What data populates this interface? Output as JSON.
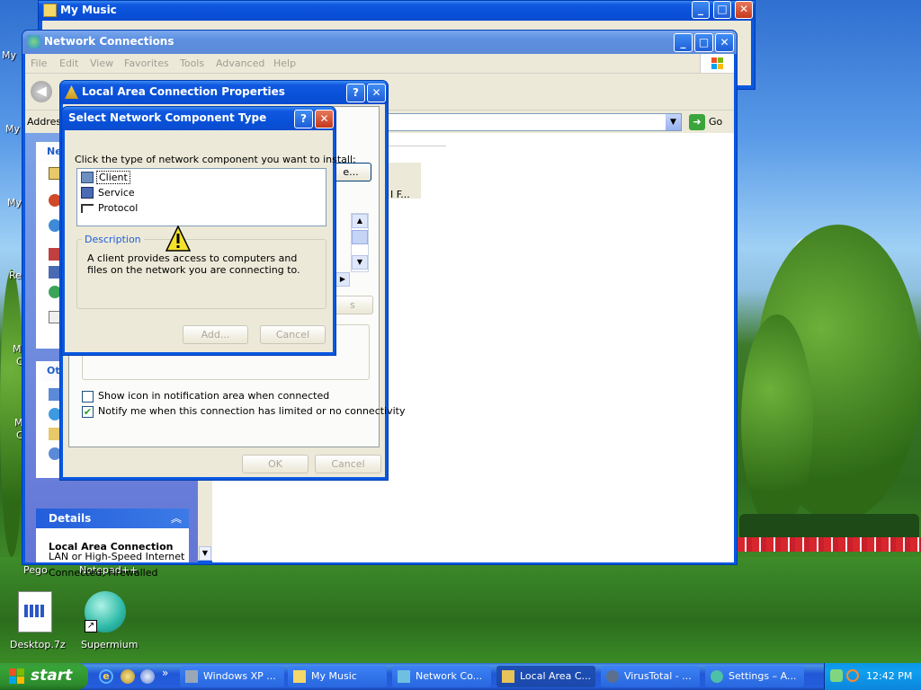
{
  "desktop": {
    "left_labels": [
      "My",
      "My",
      "My",
      "Re",
      "M",
      "C",
      "M",
      "C"
    ],
    "icons": [
      {
        "label": "Pego"
      },
      {
        "label": "Notepad++"
      },
      {
        "label": "Desktop.7z"
      },
      {
        "label": "Supermium"
      }
    ]
  },
  "my_music_window": {
    "title": "My Music"
  },
  "network_window": {
    "title": "Network Connections",
    "menu": [
      "File",
      "Edit",
      "View",
      "Favorites",
      "Tools",
      "Advanced",
      "Help"
    ],
    "address_label": "Addres",
    "go_label": "Go",
    "sidebar": {
      "network_tasks_header": "Ne",
      "other_places_header": "Ot",
      "details_header": "Details",
      "details_title": "Local Area Connection",
      "details_line1": "LAN or High-Speed Internet",
      "details_line2": "Connected, Firewalled"
    },
    "partial_text": "I F..."
  },
  "lac_properties": {
    "title": "Local Area Connection Properties",
    "help_btn": "?",
    "configure_partial": "e...",
    "properties_partial": "s",
    "show_icon_label": "Show icon in notification area when connected",
    "show_icon_checked": false,
    "notify_label": "Notify me when this connection has limited or no connectivity",
    "notify_checked": true,
    "ok_label": "OK",
    "cancel_label": "Cancel"
  },
  "select_type_dialog": {
    "title": "Select Network Component Type",
    "help_btn": "?",
    "prompt": "Click the type of network component you want to install:",
    "items": [
      {
        "label": "Client",
        "icon": "client-icon",
        "selected": true
      },
      {
        "label": "Service",
        "icon": "service-icon",
        "selected": false
      },
      {
        "label": "Protocol",
        "icon": "protocol-icon",
        "selected": false
      }
    ],
    "description_label": "Description",
    "description_text": "A client provides access to computers and files on the network you are connecting to.",
    "add_label": "Add...",
    "cancel_label": "Cancel"
  },
  "taskbar": {
    "start_label": "start",
    "quick_launch_more": "»",
    "buttons": [
      {
        "label": "Windows XP ...",
        "active": false
      },
      {
        "label": "My Music",
        "active": false
      },
      {
        "label": "Network Co...",
        "active": false
      },
      {
        "label": "Local Area C...",
        "active": true
      },
      {
        "label": "VirusTotal - ...",
        "active": false
      },
      {
        "label": "Settings – A...",
        "active": false
      }
    ],
    "clock": "12:42 PM"
  },
  "colors": {
    "xp_blue": "#0a58e0",
    "dialog_face": "#ece9d8",
    "start_green": "#35a435",
    "close_red": "#c4381a"
  }
}
